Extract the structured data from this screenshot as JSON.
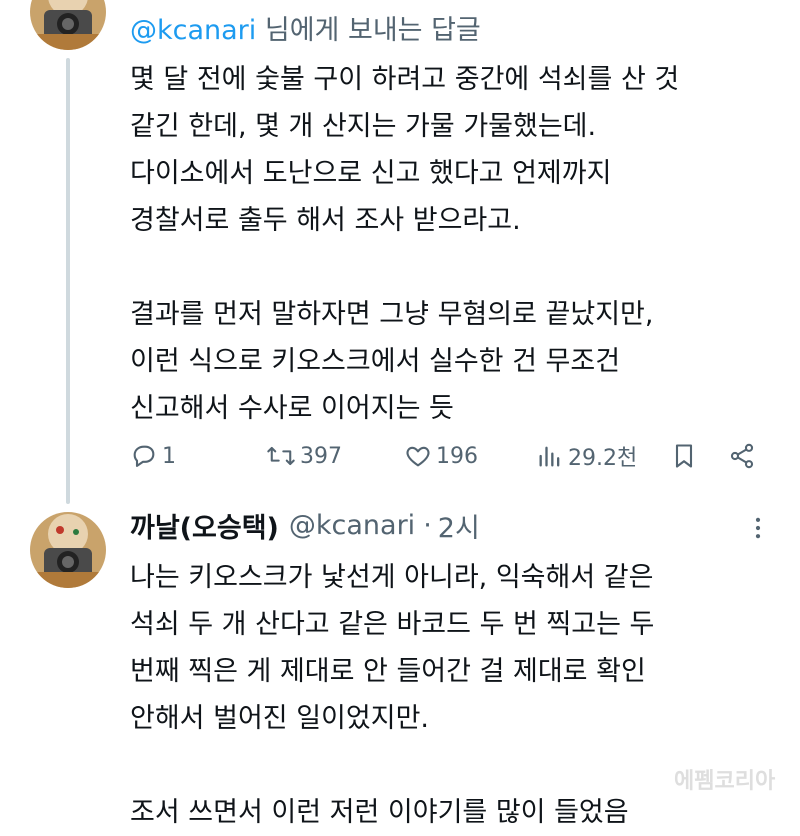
{
  "tweet1": {
    "reply_prefix_handle": "@kcanari",
    "reply_suffix": " 님에게 보내는 답글",
    "body": "몇 달 전에 숯불 구이 하려고 중간에 석쇠를 산 것\n같긴 한데, 몇 개 산지는 가물 가물했는데.\n다이소에서 도난으로 신고 했다고 언제까지\n경찰서로 출두 해서 조사 받으라고.\n\n결과를 먼저 말하자면 그냥 무혐의로 끝났지만,\n이런 식으로 키오스크에서 실수한 건 무조건\n신고해서 수사로 이어지는 듯",
    "actions": {
      "replies": "1",
      "retweets": "397",
      "likes": "196",
      "views": "29.2천"
    }
  },
  "tweet2": {
    "name": "까날(오승택)",
    "handle": "@kcanari",
    "separator": "·",
    "time": "2시",
    "body": "나는 키오스크가 낯선게 아니라, 익숙해서 같은\n석쇠 두 개 산다고 같은 바코드 두 번 찍고는 두\n번째 찍은 게 제대로 안 들어간 걸 제대로 확인\n안해서 벌어진 일이었지만.\n\n조서 쓰면서 이런 저런 이야기를 많이 들었음"
  },
  "watermark": "에펨코리아",
  "colors": {
    "link": "#1d9bf0",
    "secondary_text": "#536471",
    "primary_text": "#0f1419",
    "thread_line": "#cfd9de"
  },
  "icons": [
    "reply-icon",
    "retweet-icon",
    "like-icon",
    "views-icon",
    "bookmark-icon",
    "share-icon",
    "more-icon"
  ]
}
